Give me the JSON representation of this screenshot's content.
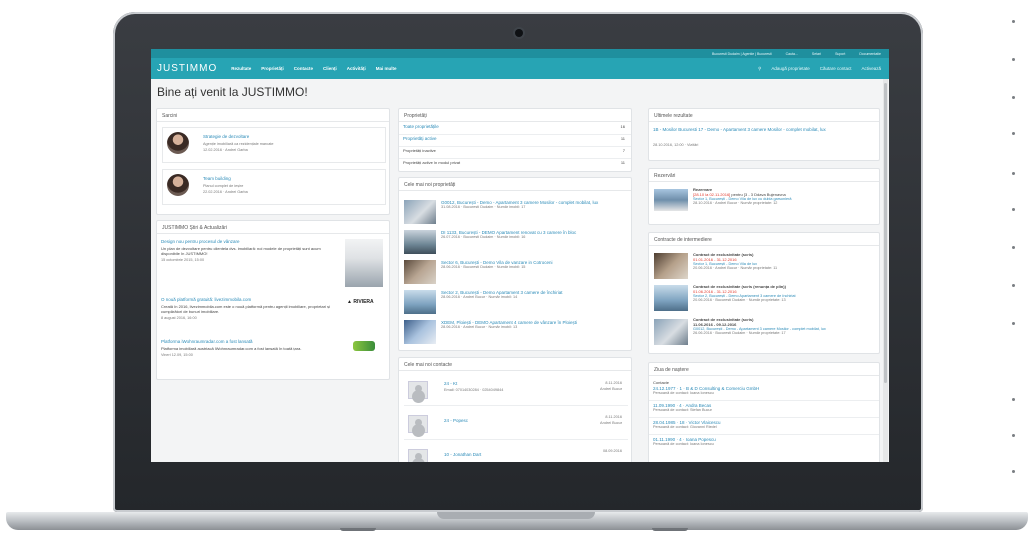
{
  "topbar": {
    "user": "Bucuresti Dudaim | Agentie | Bucuresti",
    "search": "Cauta...",
    "settings": "Setari",
    "support": "Suport",
    "docs": "Documentatie"
  },
  "nav": {
    "logo": "JUSTIMMO",
    "items": [
      "Rezultate",
      "Proprietăți",
      "Contacte",
      "Clienți",
      "Activități",
      "Mai multe"
    ],
    "right": [
      "Adaugă proprietate",
      "Căutare contact",
      "Activează"
    ]
  },
  "welcome": "Bine ați venit la JUSTIMMO!",
  "panels": {
    "sarcini": {
      "title": "Sarcini",
      "items": [
        {
          "title": "Strategie de dezvoltare",
          "desc": "Agenție imobiliară ca rezidențiale marcate",
          "date": "12.02.2016 · Andrei Garba"
        },
        {
          "title": "Team building",
          "desc": "Planul complet de ieșire",
          "date": "22.02.2016 · Andrei Garba"
        }
      ]
    },
    "stiri": {
      "title": "JUSTIMMO Știri & Actualizări",
      "items": [
        {
          "title": "Design nou pentru procesul de vânzare",
          "desc": "Un plan de dezvoltare pentru clientela dvs. imobiliară: noi modele de proprietăți sunt acum disponibile în JUSTIMMO!",
          "date": "15 octombrie 2015, 15:00"
        },
        {
          "title": "O nouă platformă gratuită: livezimmobila.com",
          "desc": "Creată în 2016, livezimmobila.com este o nouă platformă pentru agenții imobiliare, proprietari și cumpărători de bunuri imobiliare.",
          "date": "8 august 2016, 16:00",
          "brand": "RIVIERA"
        },
        {
          "title": "Platforma iWohnraumradar.com a fost lansată",
          "desc": "Platforma imobiliară austriacă iWohnraumradar.com a fost lansată în toată țara.",
          "date": "Vineri 12.09, 15:00"
        }
      ]
    },
    "proprietati": {
      "title": "Proprietăți",
      "rows": [
        {
          "label": "Toate proprietățile",
          "count": "16"
        },
        {
          "label": "Proprietăți active",
          "count": "11"
        },
        {
          "label": "Proprietăți inactive",
          "count": "7"
        },
        {
          "label": "Proprietăți active în modul privat",
          "count": "11"
        }
      ]
    },
    "noi_prop": {
      "title": "Cele mai noi proprietăți",
      "items": [
        {
          "title": "G0012, București - Demo - Apartament 3 camere Mosilor - complet mobilat, lux",
          "meta": "31.08.2016 · Bucuresti Dudaim · Număr imobil: 17"
        },
        {
          "title": "DI 1133, București - DEMO Apartament renovat cu 3 camere în bloc",
          "meta": "26.07.2016 · Bucuresti Dudaim · Număr imobil: 16"
        },
        {
          "title": "Sector 6, București - Demo Vila de vanzare in Cotroceni",
          "meta": "28.06.2016 · Bucuresti Dudaim · Număr imobil: 15"
        },
        {
          "title": "Sector 2, București - Demo Apartament 3 camere de închiriat",
          "meta": "28.06.2016 · Andrei Bucur · Număr imobil: 14"
        },
        {
          "title": "XDEM, Ploiești - DEMO Apartament 4 camere de vânzare în Ploiești",
          "meta": "28.06.2016 · Andrei Bucur · Număr imobil: 13"
        }
      ]
    },
    "noi_contacte": {
      "title": "Cele mai noi contacte",
      "items": [
        {
          "name": "24 - Kt",
          "info": "Email: 07014030284 · 0254049844",
          "date": "8.11.2016",
          "who": "Andrei Bucur"
        },
        {
          "name": "24 - Popesc",
          "info": "",
          "date": "8.11.2016",
          "who": "Andrei Bucur"
        },
        {
          "name": "10 - Jonathan Dart",
          "info": "",
          "date": "08.09.2016",
          "who": ""
        }
      ]
    },
    "ultimele": {
      "title": "Ultimele rezultate",
      "text": "1B - Mosilor Bucuresti 17 - Demo - Apartament 3 camere Mosilor - complet mobilat, lux",
      "meta": "28.10.2016, 12:00 · Vizitări"
    },
    "rezervari": {
      "title": "Rezervări",
      "label": "Rezervare",
      "dates": "[28.10 la 02.11.2016]",
      "rest": "pentru [3 - 3 Ddava Bujenavna",
      "sub": "Sector 1, București - Demo Vila de lux cu dubla garsonieră",
      "meta": "28.10.2016 · Andrei Bucur · Număr proprietate: 12"
    },
    "contracte": {
      "title": "Contracte de intermediere",
      "items": [
        {
          "type": "Contract de exclusivitate (scris)",
          "dates": "01.01.2016 - 31.12.2016",
          "sub": "Sector 1, București - Demo Vila de lux",
          "meta": "20.06.2016 · Andrei Bucur · Număr proprietate: 11"
        },
        {
          "type": "Contract de exclusivitate (scris (renunța de plin))",
          "dates": "01.06.2016 - 31.12.2016",
          "sub": "Sector 2, București - Demo Apartament 3 camere de închiriat",
          "meta": "20.06.2016 · Bucuresti Dudaim · Număr proprietate: 13"
        },
        {
          "type": "Contract de exclusivitate (scris)",
          "dates": "11.06.2016 - 09.12.2016",
          "sub": "G0012, București - Demo - Apartament 3 camere Mosilor - complet mobilat, lux",
          "meta": "26.06.2016 · Bucuresti Dudaim · Număr proprietate: 17"
        }
      ]
    },
    "ziua": {
      "title": "Ziua de naștere",
      "section": "Contacte",
      "items": [
        {
          "name": "24.12.1977 · 1 · B & D Consulting & Comerciu GmbH",
          "sub": "Persoană de contact: Ioana Ionescu"
        },
        {
          "name": "11.09.1990 · 4 · Andra Becas",
          "sub": "Persoană de contact: Stefan Bucur"
        },
        {
          "name": "28.04.1985 · 18 · Victor Vlaicescu",
          "sub": "Persoană de contact: Giovanni Riedel"
        },
        {
          "name": "01.11.1990 · 4 · Ioana Popescu",
          "sub": "Persoană de contact: Ioana Ionescu"
        }
      ]
    }
  },
  "colors": {
    "topbar": "#1f8f9e",
    "navbar": "#27a4b4",
    "link": "#2b8bb8",
    "alert": "#e23b2e"
  }
}
